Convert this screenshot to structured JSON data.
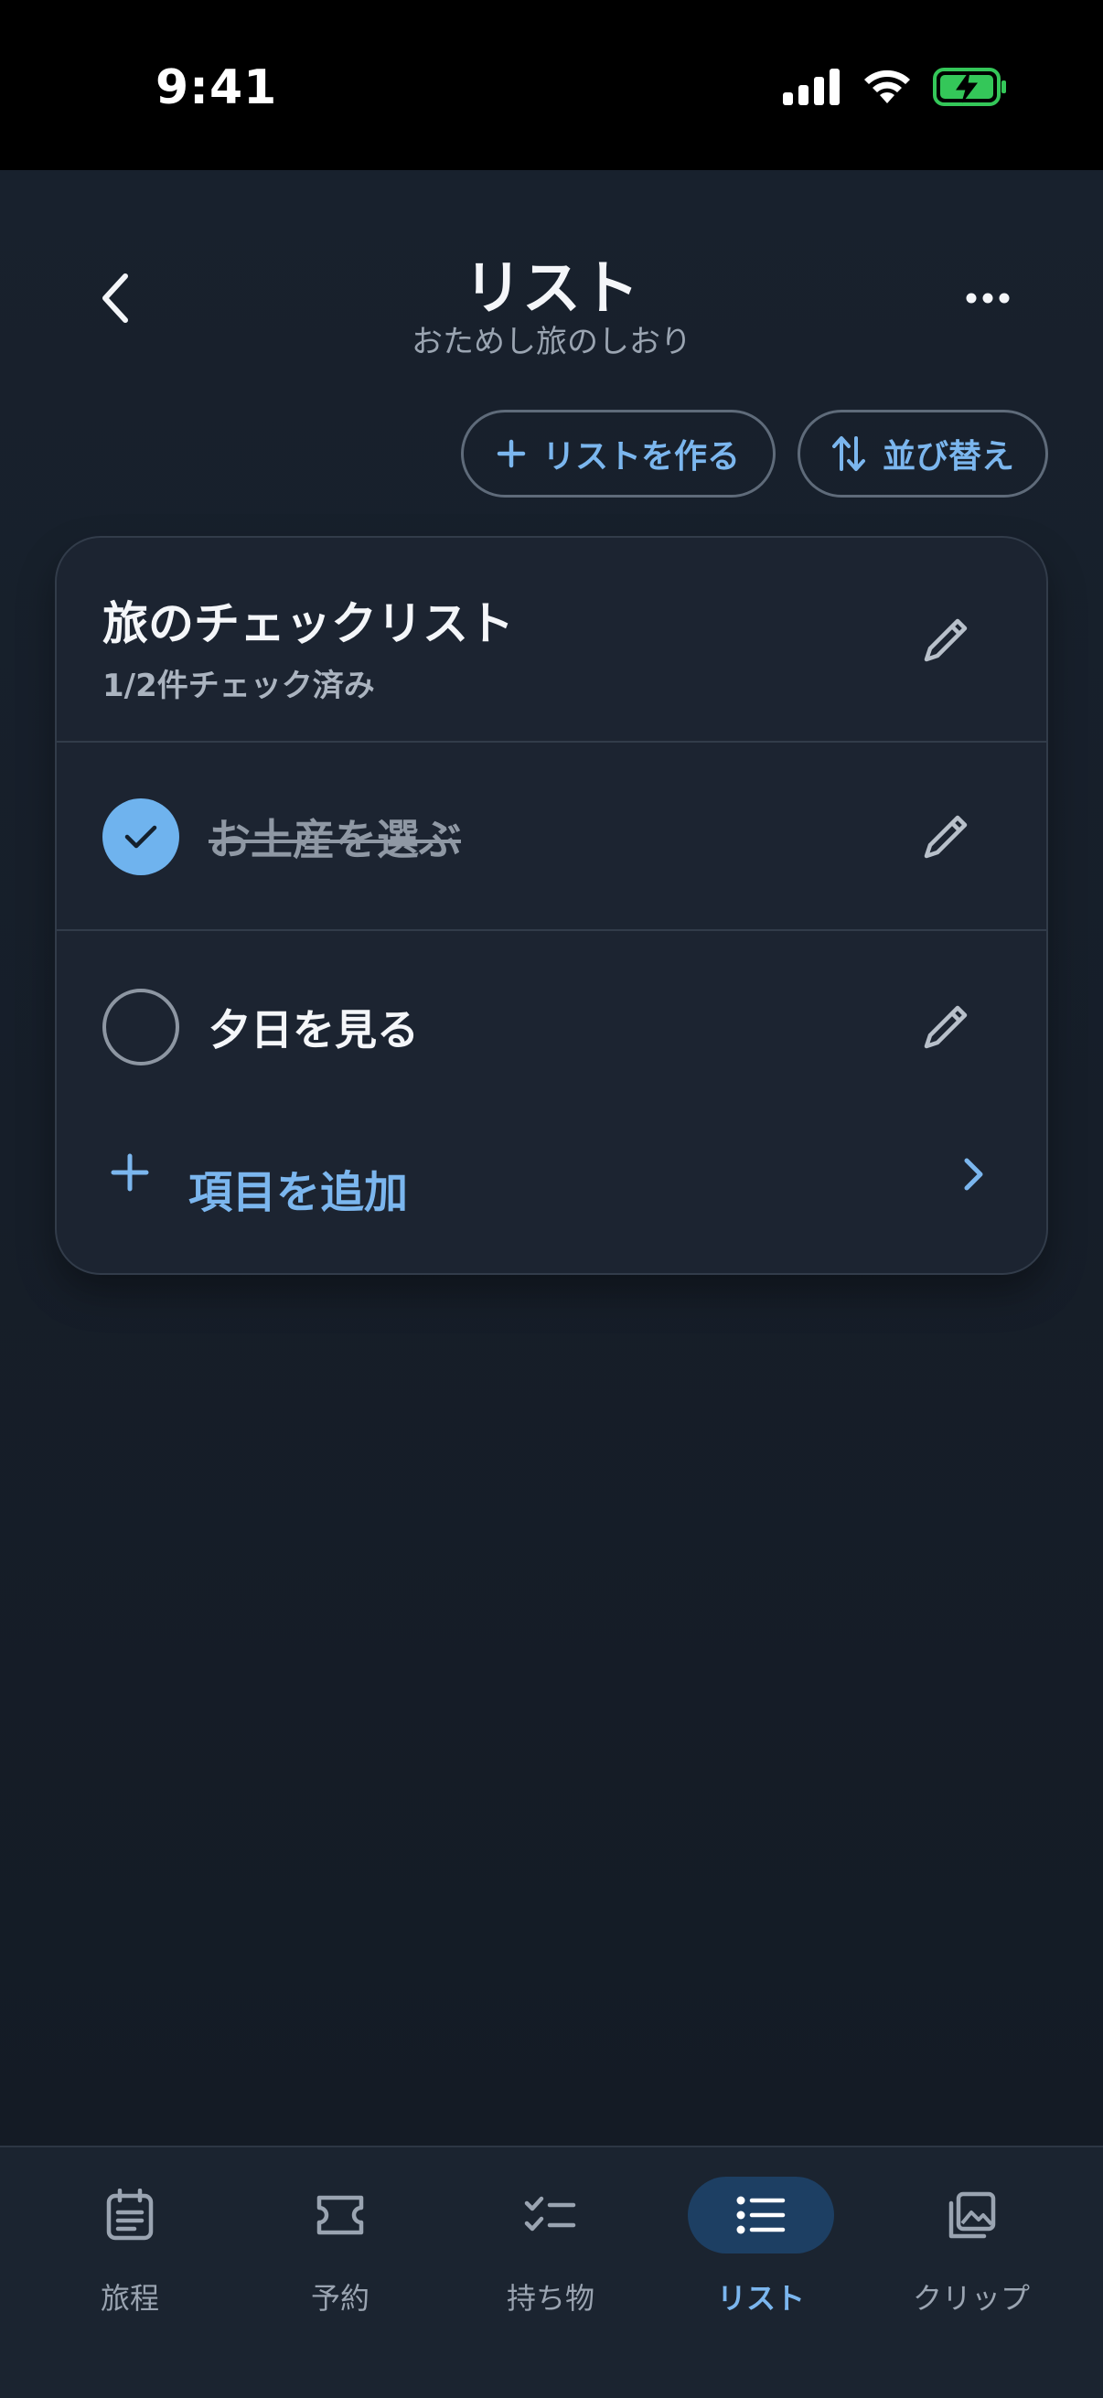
{
  "status_bar": {
    "time": "9:41",
    "icons": [
      "signal-icon",
      "wifi-icon",
      "battery-charging-icon"
    ]
  },
  "header": {
    "title": "リスト",
    "subtitle": "おためし旅のしおり",
    "back_icon": "chevron-left-icon",
    "more_icon": "ellipsis-icon"
  },
  "actions": {
    "create_list_label": "リストを作る",
    "sort_label": "並び替え"
  },
  "list_card": {
    "title": "旅のチェックリスト",
    "progress_text": "1/2件チェック済み",
    "items": [
      {
        "label": "お土産を選ぶ",
        "checked": true
      },
      {
        "label": "夕日を見る",
        "checked": false
      }
    ],
    "add_item_label": "項目を追加"
  },
  "tab_bar": {
    "tabs": [
      {
        "label": "旅程",
        "icon": "calendar-list-icon",
        "active": false
      },
      {
        "label": "予約",
        "icon": "ticket-icon",
        "active": false
      },
      {
        "label": "持ち物",
        "icon": "checklist-icon",
        "active": false
      },
      {
        "label": "リスト",
        "icon": "bullet-list-icon",
        "active": true
      },
      {
        "label": "クリップ",
        "icon": "photo-stack-icon",
        "active": false
      }
    ]
  },
  "colors": {
    "accent": "#7bb6ee",
    "background": "#141b25",
    "card": "#1c2431",
    "check_done": "#6fb3ee",
    "battery": "#34c759"
  }
}
